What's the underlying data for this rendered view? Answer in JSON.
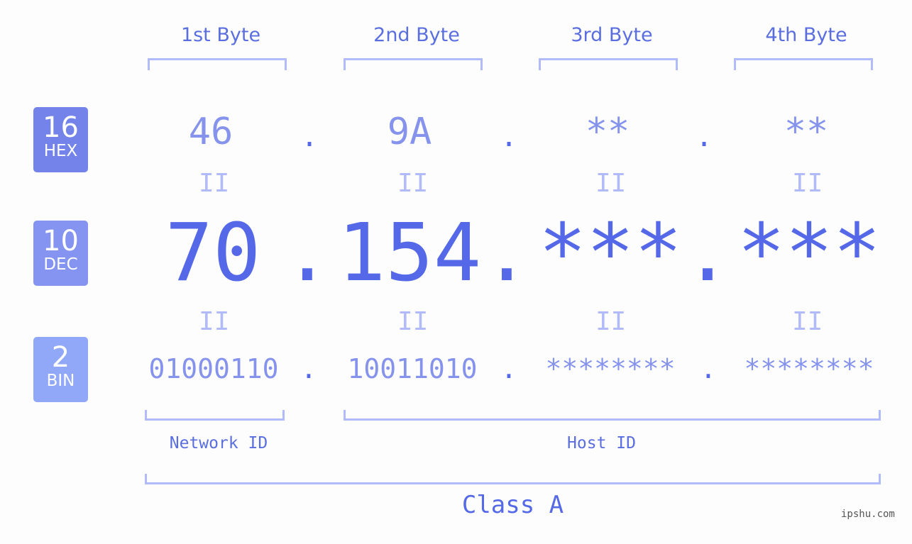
{
  "byte_headers": [
    "1st Byte",
    "2nd Byte",
    "3rd Byte",
    "4th Byte"
  ],
  "badges": {
    "hex": {
      "base": "16",
      "label": "HEX",
      "color": "#7383ea"
    },
    "dec": {
      "base": "10",
      "label": "DEC",
      "color": "#8594f0"
    },
    "bin": {
      "base": "2",
      "label": "BIN",
      "color": "#91a7f8"
    }
  },
  "hex_values": [
    "46",
    "9A",
    "**",
    "**"
  ],
  "dec_values": [
    "70",
    "154",
    "***",
    "***"
  ],
  "bin_values": [
    "01000110",
    "10011010",
    "********",
    "********"
  ],
  "separator": ".",
  "equals": "II",
  "network_id_label": "Network ID",
  "host_id_label": "Host ID",
  "class_label": "Class A",
  "footer": "ipshu.com"
}
